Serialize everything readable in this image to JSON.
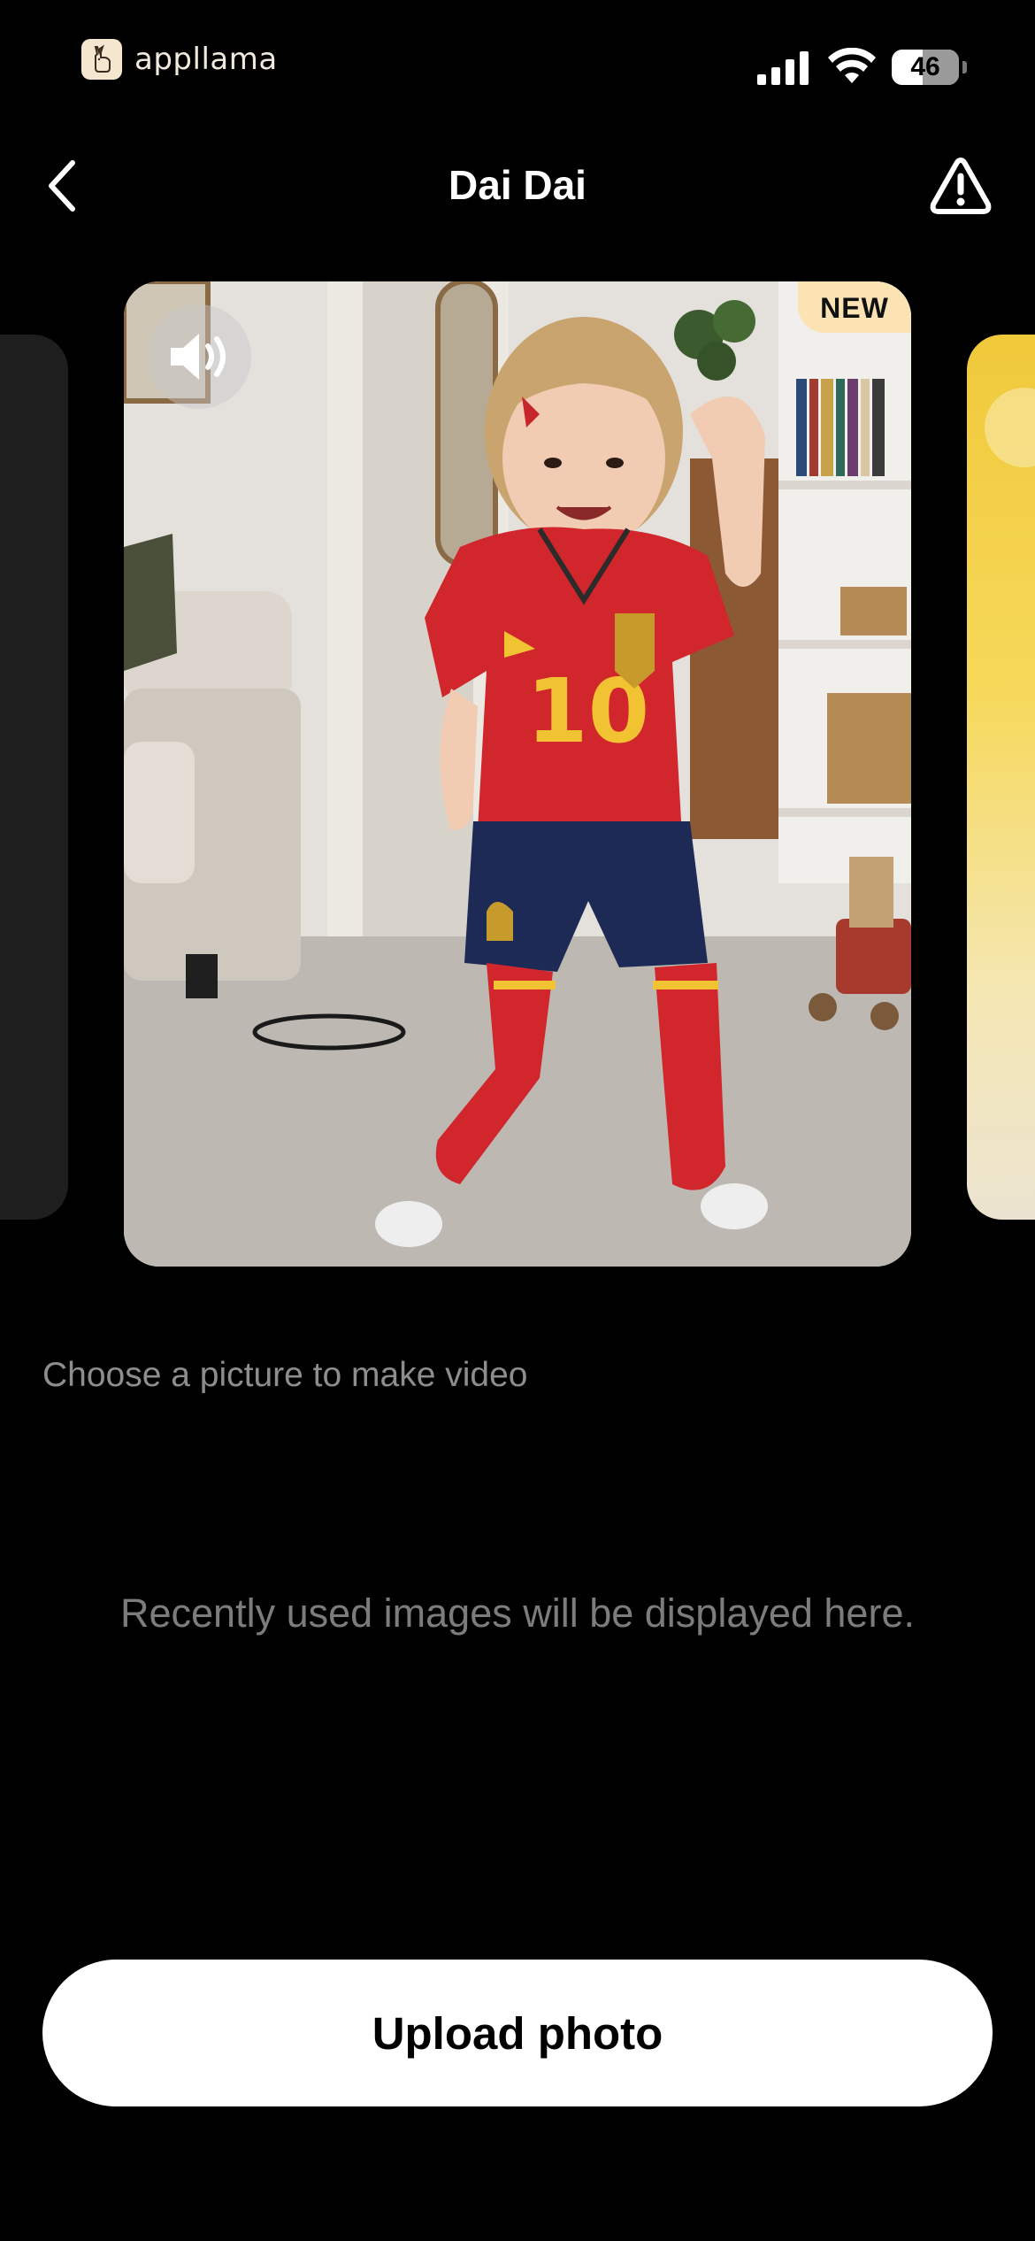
{
  "status_bar": {
    "brand": "appllama",
    "battery": "46",
    "battery_level_percent": 46
  },
  "nav": {
    "title": "Dai Dai",
    "back_icon": "chevron-left-icon",
    "report_icon": "warning-triangle-icon"
  },
  "carousel": {
    "main_card": {
      "badge": "NEW",
      "sound_icon": "speaker-icon"
    }
  },
  "picker": {
    "section_label": "Choose a picture to make video",
    "empty_message": "Recently used images will be displayed here."
  },
  "upload": {
    "label": "Upload photo"
  },
  "colors": {
    "background": "#000000",
    "badge": "#fbe3b3",
    "button": "#ffffff",
    "muted_text": "#8d8d8d"
  }
}
